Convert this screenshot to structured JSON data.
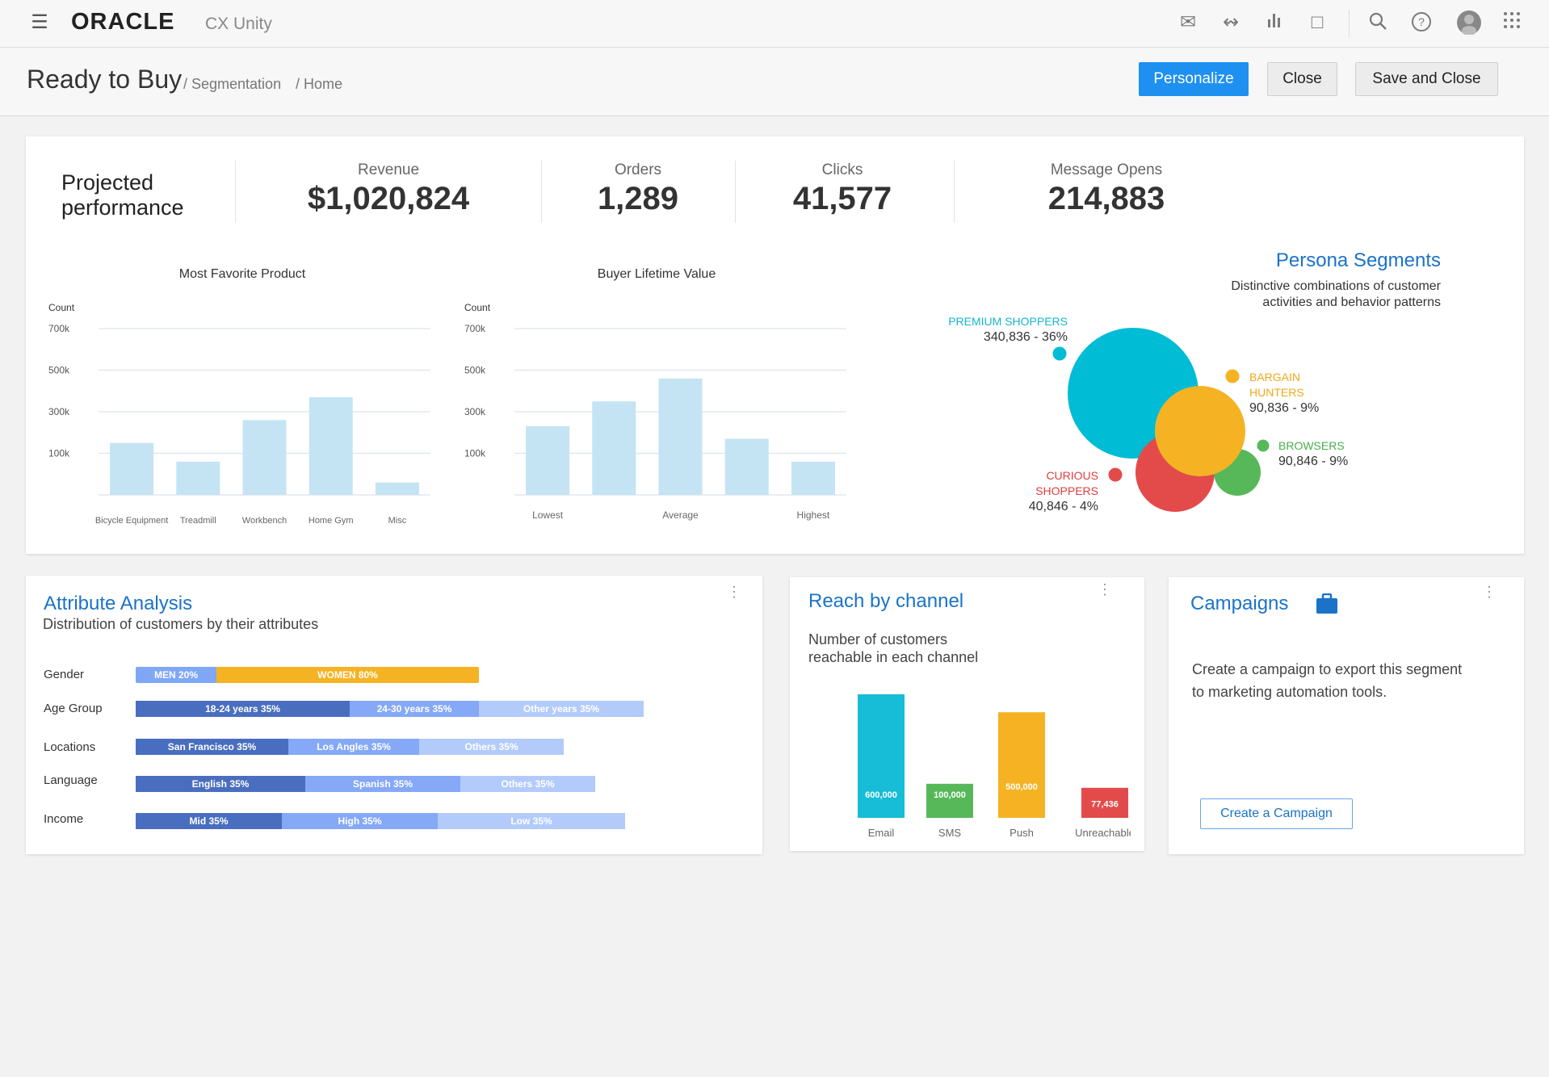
{
  "header": {
    "logo": "ORACLE",
    "product": "CX Unity",
    "icons": [
      "menu-icon",
      "mail-icon",
      "flow-icon",
      "bar-chart-icon",
      "chat-icon",
      "search-icon",
      "help-icon",
      "avatar-icon",
      "apps-grid-icon"
    ]
  },
  "titlebar": {
    "title": "Ready to Buy",
    "breadcrumb": [
      "/ Segmentation",
      "/ Home"
    ],
    "buttons": {
      "personalize": "Personalize",
      "close": "Close",
      "save_close": "Save and Close"
    }
  },
  "colors": {
    "accent": "#1e90f0",
    "title_blue": "#1a73c9",
    "cyan": "#00bcd4",
    "orange": "#f5b324",
    "green": "#57b85a",
    "red": "#e34b4b",
    "bar_light": "#c5e4f3"
  },
  "performance": {
    "title_line1": "Projected",
    "title_line2": "performance",
    "kpis": [
      {
        "label": "Revenue",
        "value": "$1,020,824"
      },
      {
        "label": "Orders",
        "value": "1,289"
      },
      {
        "label": "Clicks",
        "value": "41,577"
      },
      {
        "label": "Message Opens",
        "value": "214,883"
      }
    ]
  },
  "chart_data": [
    {
      "type": "bar",
      "title": "Most Favorite Product",
      "ylabel": "Count",
      "yticks": [
        "100k",
        "300k",
        "500k",
        "700k"
      ],
      "ytick_values": [
        100000,
        300000,
        500000,
        700000
      ],
      "categories": [
        "Bicycle Equipment",
        "Treadmill",
        "Workbench",
        "Home Gym",
        "Misc"
      ],
      "values": [
        150000,
        80000,
        260000,
        370000,
        30000
      ],
      "grid": true
    },
    {
      "type": "bar",
      "title": "Buyer Lifetime Value",
      "ylabel": "Count",
      "yticks": [
        "100k",
        "300k",
        "500k",
        "700k"
      ],
      "ytick_values": [
        100000,
        300000,
        500000,
        700000
      ],
      "categories": [
        "Lowest",
        "",
        "Average",
        "",
        "Highest"
      ],
      "values": [
        230000,
        350000,
        460000,
        170000,
        80000
      ],
      "grid": true
    },
    {
      "type": "bar",
      "title": "Reach by channel",
      "categories": [
        "Email",
        "SMS",
        "Push",
        "Unreachable"
      ],
      "values": [
        600000,
        100000,
        500000,
        77436
      ],
      "data_labels": [
        "600,000",
        "100,000",
        "500,000",
        "77,436"
      ],
      "colors": [
        "#17bcd6",
        "#57b85a",
        "#f5b324",
        "#e34b4b"
      ]
    }
  ],
  "persona": {
    "title": "Persona Segments",
    "subtitle_line1": "Distinctive combinations of customer",
    "subtitle_line2": "activities and behavior patterns",
    "segments": [
      {
        "name_line1": "PREMIUM SHOPPERS",
        "name_line2": "",
        "value": "340,836 - 36%",
        "color": "#00bcd4"
      },
      {
        "name_line1": "BARGAIN",
        "name_line2": "HUNTERS",
        "value": "90,836 - 9%",
        "color": "#f5b324"
      },
      {
        "name_line1": "BROWSERS",
        "name_line2": "",
        "value": "90,846 - 9%",
        "color": "#57b85a"
      },
      {
        "name_line1": "CURIOUS",
        "name_line2": "SHOPPERS",
        "value": "40,846 - 4%",
        "color": "#e34b4b"
      }
    ]
  },
  "attributes": {
    "title": "Attribute Analysis",
    "subtitle": "Distribution of customers by their attributes",
    "rows": [
      {
        "label": "Gender",
        "segments": [
          "MEN 20%",
          "WOMEN 80%"
        ]
      },
      {
        "label": "Age Group",
        "segments": [
          "18-24 years 35%",
          "24-30 years 35%",
          "Other years 35%"
        ]
      },
      {
        "label": "Locations",
        "segments": [
          "San Francisco 35%",
          "Los Angles 35%",
          "Others 35%"
        ]
      },
      {
        "label": "Language",
        "segments": [
          "English 35%",
          "Spanish 35%",
          "Others 35%"
        ]
      },
      {
        "label": "Income",
        "segments": [
          "Mid 35%",
          "High 35%",
          "Low 35%"
        ]
      }
    ]
  },
  "reach": {
    "title": "Reach by channel",
    "subtitle_line1": "Number of customers",
    "subtitle_line2": "reachable in each channel"
  },
  "campaigns": {
    "title": "Campaigns",
    "text_line1": "Create a campaign to export this segment",
    "text_line2": "to marketing automation tools.",
    "button": "Create a Campaign"
  }
}
